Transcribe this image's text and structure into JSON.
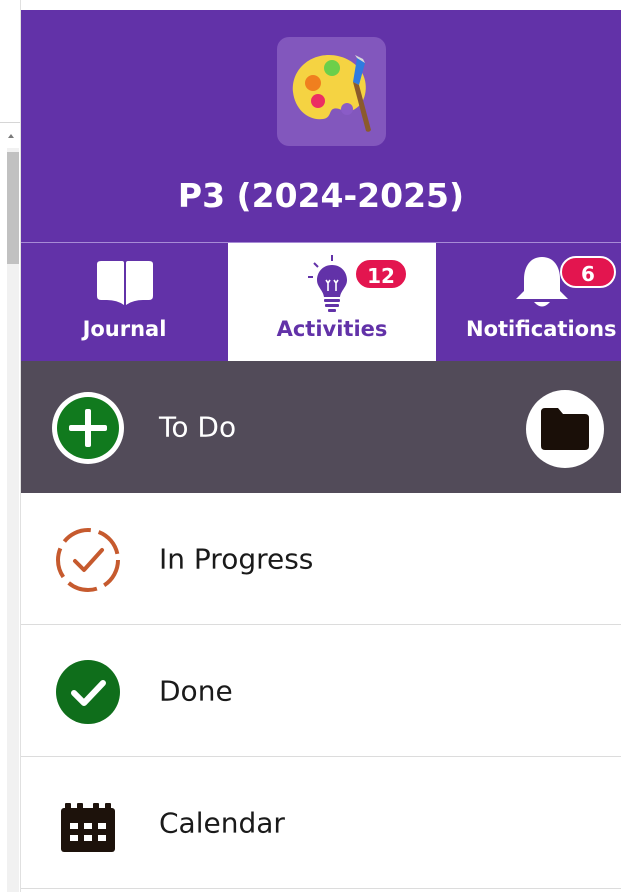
{
  "header": {
    "class_title": "P3 (2024-2025)",
    "logo_icon": "palette-icon",
    "background_color": "#6232a8"
  },
  "tabs": [
    {
      "label": "Journal",
      "icon": "book-icon",
      "active": false
    },
    {
      "label": "Activities",
      "icon": "lightbulb-icon",
      "badge": "12",
      "active": true
    },
    {
      "label": "Notifications",
      "icon": "bell-icon",
      "badge": "6",
      "active": false
    }
  ],
  "menu": {
    "items": [
      {
        "label": "To Do",
        "icon": "plus-circle-icon",
        "icon_color": "#117a1e",
        "active": true,
        "action_icon": "folder-icon"
      },
      {
        "label": "In Progress",
        "icon": "dashed-check-circle-icon",
        "icon_color": "#c65a2e",
        "active": false
      },
      {
        "label": "Done",
        "icon": "check-circle-icon",
        "icon_color": "#0f6e1b",
        "active": false
      },
      {
        "label": "Calendar",
        "icon": "calendar-icon",
        "icon_color": "#1d120b",
        "active": false
      }
    ]
  },
  "colors": {
    "accent": "#6232a8",
    "badge": "#e3154f",
    "active_row": "#524b59"
  }
}
